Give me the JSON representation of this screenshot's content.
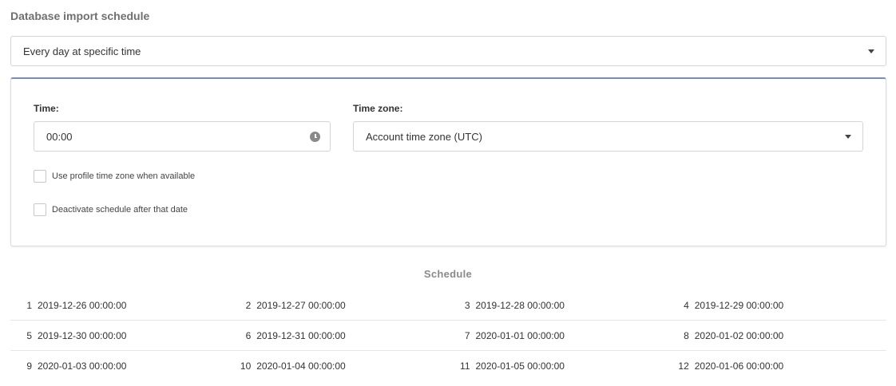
{
  "section_title": "Database import schedule",
  "frequency": {
    "selected": "Every day at specific time"
  },
  "time": {
    "label": "Time:",
    "value": "00:00"
  },
  "timezone": {
    "label": "Time zone:",
    "selected": "Account time zone (UTC)"
  },
  "options": {
    "profile_tz_label": "Use profile time zone when available",
    "profile_tz_checked": false,
    "deactivate_label": "Deactivate schedule after that date",
    "deactivate_checked": false
  },
  "schedule": {
    "title": "Schedule",
    "rows": [
      [
        {
          "index": "1",
          "datetime": "2019-12-26 00:00:00"
        },
        {
          "index": "2",
          "datetime": "2019-12-27 00:00:00"
        },
        {
          "index": "3",
          "datetime": "2019-12-28 00:00:00"
        },
        {
          "index": "4",
          "datetime": "2019-12-29 00:00:00"
        }
      ],
      [
        {
          "index": "5",
          "datetime": "2019-12-30 00:00:00"
        },
        {
          "index": "6",
          "datetime": "2019-12-31 00:00:00"
        },
        {
          "index": "7",
          "datetime": "2020-01-01 00:00:00"
        },
        {
          "index": "8",
          "datetime": "2020-01-02 00:00:00"
        }
      ],
      [
        {
          "index": "9",
          "datetime": "2020-01-03 00:00:00"
        },
        {
          "index": "10",
          "datetime": "2020-01-04 00:00:00"
        },
        {
          "index": "11",
          "datetime": "2020-01-05 00:00:00"
        },
        {
          "index": "12",
          "datetime": "2020-01-06 00:00:00"
        }
      ]
    ]
  }
}
